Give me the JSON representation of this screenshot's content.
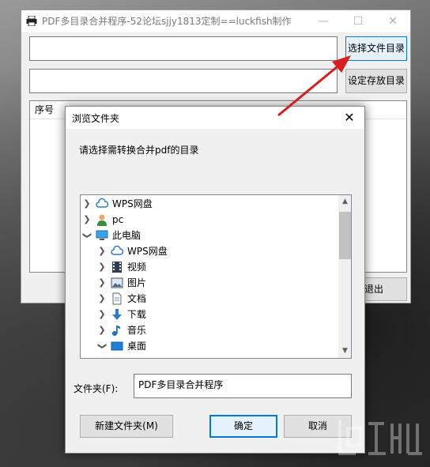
{
  "main": {
    "title": "PDF多目录合并程序-52论坛sjjy1813定制==luckfish制作",
    "select_dir_button": "选择文件目录",
    "set_save_button": "设定存放目录",
    "list_header_index": "序号",
    "exit_button": "退出"
  },
  "dialog": {
    "title": "浏览文件夹",
    "prompt": "请选择需转换合并pdf的目录",
    "tree": [
      {
        "label": "WPS网盘",
        "icon": "cloud-icon"
      },
      {
        "label": "pc",
        "icon": "user-icon"
      },
      {
        "label": "此电脑",
        "icon": "computer-icon"
      },
      {
        "label": "WPS网盘",
        "icon": "cloud-icon"
      },
      {
        "label": "视频",
        "icon": "video-icon"
      },
      {
        "label": "图片",
        "icon": "pictures-icon"
      },
      {
        "label": "文档",
        "icon": "documents-icon"
      },
      {
        "label": "下载",
        "icon": "download-icon"
      },
      {
        "label": "音乐",
        "icon": "music-icon"
      },
      {
        "label": "桌面",
        "icon": "desktop-icon"
      }
    ],
    "folder_label": "文件夹(F):",
    "folder_value": "PDF多目录合并程序",
    "new_folder_button": "新建文件夹(M)",
    "ok_button": "确定",
    "cancel_button": "取消"
  },
  "colors": {
    "accent_blue": "#0078d7",
    "arrow_red": "#d81e1e"
  }
}
